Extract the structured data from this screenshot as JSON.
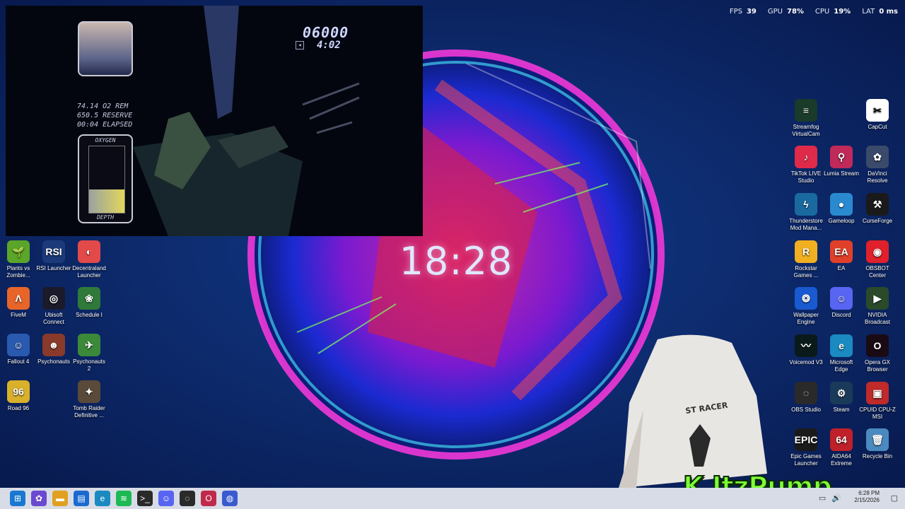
{
  "overlay": {
    "fps_label": "FPS",
    "fps_value": "39",
    "gpu_label": "GPU",
    "gpu_value": "78%",
    "cpu_label": "CPU",
    "cpu_value": "19%",
    "lat_label": "LAT",
    "lat_value": "0 ms"
  },
  "wallpaper": {
    "clock": "18:28"
  },
  "game": {
    "score": "06000",
    "timer": "4:02",
    "stats": [
      "74.14 O2 REM",
      "650.5 RESERVE",
      "00:04 ELAPSED"
    ],
    "oxygen_label": "OXYGEN",
    "depth_label": "DEPTH",
    "oxygen_level": 0.35
  },
  "desktop_left": [
    {
      "label": "Plants vs Zombie...",
      "icon": "plants-vs-zombies-icon",
      "color": "#5aa52a",
      "glyph": "🌱"
    },
    {
      "label": "RSI Launcher",
      "icon": "rsi-launcher-icon",
      "color": "#1c3a7a",
      "glyph": "RSI"
    },
    {
      "label": "Decentraland Launcher",
      "icon": "decentraland-icon",
      "color": "#e24a4a",
      "glyph": "◐"
    },
    {
      "label": "FiveM",
      "icon": "fivem-icon",
      "color": "#e8652a",
      "glyph": "Λ"
    },
    {
      "label": "Ubisoft Connect",
      "icon": "ubisoft-icon",
      "color": "#1a1a2a",
      "glyph": "◎"
    },
    {
      "label": "Schedule I",
      "icon": "schedule-i-icon",
      "color": "#2f7a3a",
      "glyph": "❀"
    },
    {
      "label": "Fallout 4",
      "icon": "fallout-4-icon",
      "color": "#2a5ab0",
      "glyph": "☺"
    },
    {
      "label": "Psychonauts",
      "icon": "psychonauts-icon",
      "color": "#8a3a2a",
      "glyph": "☻"
    },
    {
      "label": "Psychonauts 2",
      "icon": "psychonauts-2-icon",
      "color": "#3a8a3a",
      "glyph": "✈"
    },
    {
      "label": "Road 96",
      "icon": "road-96-icon",
      "color": "#d8b02a",
      "glyph": "96"
    },
    {
      "label": "Tomb Raider Definitive ...",
      "icon": "tomb-raider-icon",
      "color": "#5a4a3a",
      "glyph": "✦"
    }
  ],
  "desktop_right": [
    {
      "label": "Streamfog VirtualCam",
      "icon": "streamfog-icon",
      "color": "#1a3a2a",
      "glyph": "≡"
    },
    {
      "label": "CapCut",
      "icon": "capcut-icon",
      "color": "#ffffff",
      "glyph": "✂"
    },
    {
      "label": "TikTok LIVE Studio",
      "icon": "tiktok-live-icon",
      "color": "#e02a4a",
      "glyph": "♪"
    },
    {
      "label": "Lumia Stream",
      "icon": "lumia-stream-icon",
      "color": "#c02a5a",
      "glyph": "⚲"
    },
    {
      "label": "DaVinci Resolve",
      "icon": "davinci-resolve-icon",
      "color": "#3a4a6a",
      "glyph": "✿"
    },
    {
      "label": "Thunderstore Mod Mana...",
      "icon": "thunderstore-icon",
      "color": "#1a6aa0",
      "glyph": "ϟ"
    },
    {
      "label": "Gameloop",
      "icon": "gameloop-icon",
      "color": "#2a8ad0",
      "glyph": "●"
    },
    {
      "label": "CurseForge",
      "icon": "curseforge-icon",
      "color": "#1a1a1a",
      "glyph": "⚒"
    },
    {
      "label": "Rockstar Games ...",
      "icon": "rockstar-icon",
      "color": "#f0b020",
      "glyph": "R"
    },
    {
      "label": "EA",
      "icon": "ea-icon",
      "color": "#e0402a",
      "glyph": "EA"
    },
    {
      "label": "OBSBOT Center",
      "icon": "obsbot-icon",
      "color": "#e0202a",
      "glyph": "◉"
    },
    {
      "label": "Wallpaper Engine",
      "icon": "wallpaper-engine-icon",
      "color": "#1a5ad0",
      "glyph": "❂"
    },
    {
      "label": "Discord",
      "icon": "discord-icon",
      "color": "#5865f2",
      "glyph": "☺"
    },
    {
      "label": "NVIDIA Broadcast",
      "icon": "nvidia-broadcast-icon",
      "color": "#2a4a2a",
      "glyph": "▶"
    },
    {
      "label": "Voicemod V3",
      "icon": "voicemod-icon",
      "color": "#0a1a1a",
      "glyph": "〰"
    },
    {
      "label": "Microsoft Edge",
      "icon": "edge-icon",
      "color": "#1a8ac0",
      "glyph": "e"
    },
    {
      "label": "Opera GX Browser",
      "icon": "opera-gx-icon",
      "color": "#1a0a14",
      "glyph": "O"
    },
    {
      "label": "OBS Studio",
      "icon": "obs-studio-icon",
      "color": "#2a2a2a",
      "glyph": "◌"
    },
    {
      "label": "Steam",
      "icon": "steam-icon",
      "color": "#1a3a5a",
      "glyph": "⚙"
    },
    {
      "label": "CPUID CPU-Z MSI",
      "icon": "cpu-z-icon",
      "color": "#c02a2a",
      "glyph": "▣"
    },
    {
      "label": "Epic Games Launcher",
      "icon": "epic-games-icon",
      "color": "#1a1a1a",
      "glyph": "EPIC"
    },
    {
      "label": "AIDA64 Extreme",
      "icon": "aida64-icon",
      "color": "#c0202a",
      "glyph": "64"
    },
    {
      "label": "Recycle Bin",
      "icon": "recycle-bin-icon",
      "color": "#4a8ac0",
      "glyph": "🗑"
    }
  ],
  "taskbar": {
    "items": [
      {
        "icon": "start-icon",
        "color": "#1a78d0",
        "glyph": "⊞"
      },
      {
        "icon": "copilot-icon",
        "color": "#6a4ad0",
        "glyph": "✿"
      },
      {
        "icon": "file-explorer-icon",
        "color": "#e0a020",
        "glyph": "▬"
      },
      {
        "icon": "microsoft-store-icon",
        "color": "#1a6ad0",
        "glyph": "▤"
      },
      {
        "icon": "edge-taskbar-icon",
        "color": "#1a8ac0",
        "glyph": "e"
      },
      {
        "icon": "spotify-icon",
        "color": "#1db954",
        "glyph": "≋"
      },
      {
        "icon": "terminal-icon",
        "color": "#2a2a2a",
        "glyph": ">_"
      },
      {
        "icon": "discord-taskbar-icon",
        "color": "#5865f2",
        "glyph": "☺"
      },
      {
        "icon": "obs-taskbar-icon",
        "color": "#2a2a2a",
        "glyph": "◌"
      },
      {
        "icon": "opera-taskbar-icon",
        "color": "#c02a4a",
        "glyph": "O"
      },
      {
        "icon": "app-taskbar-icon",
        "color": "#3a5ad0",
        "glyph": "◍"
      }
    ],
    "time": "6:28 PM",
    "date": "2/15/2026"
  },
  "streamer_name": "ItzPump",
  "chair_text": "ST RACER"
}
